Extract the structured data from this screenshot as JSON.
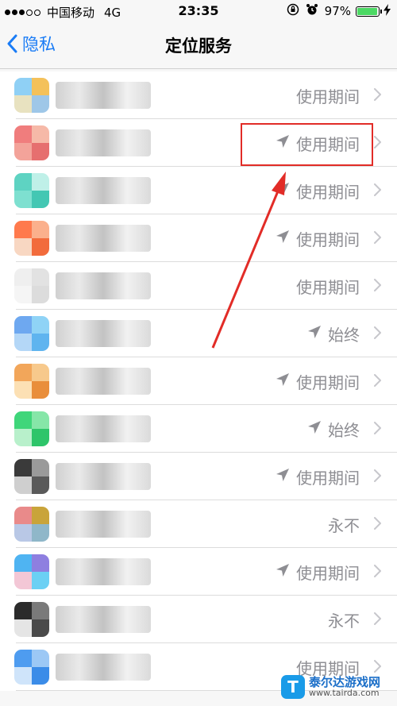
{
  "status": {
    "carrier": "中国移动",
    "network": "4G",
    "time": "23:35",
    "battery": "97%",
    "battery_level": 0.97
  },
  "nav": {
    "back_label": "隐私",
    "title": "定位服务"
  },
  "rows": [
    {
      "status": "使用期间",
      "location_arrow": false,
      "icon_colors": [
        "#8fd0f5",
        "#f4c15a",
        "#e8e2c0",
        "#9ec7e8"
      ]
    },
    {
      "status": "使用期间",
      "location_arrow": true,
      "icon_colors": [
        "#f07d7d",
        "#f6b9a8",
        "#f3a39a",
        "#e66f6f"
      ]
    },
    {
      "status": "使用期间",
      "location_arrow": true,
      "icon_colors": [
        "#5ed3c2",
        "#bff0e8",
        "#7ee0d0",
        "#43c7b3"
      ]
    },
    {
      "status": "使用期间",
      "location_arrow": true,
      "icon_colors": [
        "#ff7a4d",
        "#fbb08c",
        "#f8d7c2",
        "#f26b3c"
      ]
    },
    {
      "status": "使用期间",
      "location_arrow": false,
      "icon_colors": [
        "#efefef",
        "#e2e2e2",
        "#f5f5f5",
        "#dcdcdc"
      ]
    },
    {
      "status": "始终",
      "location_arrow": true,
      "icon_colors": [
        "#6ea8f0",
        "#8fd3f6",
        "#b4d7f7",
        "#5fb4ef"
      ]
    },
    {
      "status": "使用期间",
      "location_arrow": true,
      "icon_colors": [
        "#f2a65a",
        "#f7c98c",
        "#fce0b4",
        "#e98e3b"
      ]
    },
    {
      "status": "始终",
      "location_arrow": true,
      "icon_colors": [
        "#3fd67a",
        "#86e6a8",
        "#b8f0cb",
        "#2ec56a"
      ]
    },
    {
      "status": "使用期间",
      "location_arrow": true,
      "icon_colors": [
        "#3a3a3a",
        "#9a9a9a",
        "#cfcfcf",
        "#5a5a5a"
      ]
    },
    {
      "status": "永不",
      "location_arrow": false,
      "icon_colors": [
        "#e98a8a",
        "#c9a43a",
        "#b9c8e6",
        "#8fb7c9"
      ]
    },
    {
      "status": "使用期间",
      "location_arrow": true,
      "icon_colors": [
        "#4fb4f2",
        "#8e7fe0",
        "#f3c7d6",
        "#6bd0f4"
      ]
    },
    {
      "status": "永不",
      "location_arrow": false,
      "icon_colors": [
        "#2b2b2b",
        "#7a7a7a",
        "#e5e5e5",
        "#4a4a4a"
      ]
    },
    {
      "status": "使用期间",
      "location_arrow": false,
      "icon_colors": [
        "#4e9cf0",
        "#9cc8f5",
        "#cfe4fa",
        "#3b8ce8"
      ]
    }
  ],
  "annotation_color": "#e22c27",
  "watermark": {
    "logo": "T",
    "name": "泰尔达游戏网",
    "url": "www.tairda.com"
  }
}
